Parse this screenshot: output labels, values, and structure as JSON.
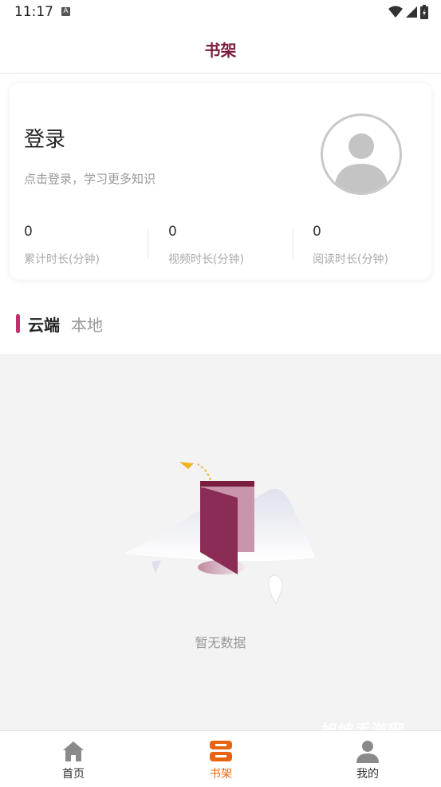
{
  "status_bar": {
    "time": "11:17",
    "notification_icon": "A"
  },
  "header": {
    "title": "书架"
  },
  "profile_card": {
    "title": "登录",
    "subtitle": "点击登录，学习更多知识",
    "stats": [
      {
        "value": "0",
        "label": "累计时长(分钟)"
      },
      {
        "value": "0",
        "label": "视频时长(分钟)"
      },
      {
        "value": "0",
        "label": "阅读时长(分钟)"
      }
    ]
  },
  "tabs": {
    "cloud": "云端",
    "local": "本地"
  },
  "empty_state": {
    "text": "暂无数据"
  },
  "bottom_nav": {
    "items": [
      {
        "label": "首页",
        "icon": "home-icon",
        "color": "#333333"
      },
      {
        "label": "书架",
        "icon": "bookshelf-icon",
        "color": "#e8650f"
      },
      {
        "label": "我的",
        "icon": "user-icon",
        "color": "#333333"
      }
    ]
  },
  "colors": {
    "accent": "#7a1d3e",
    "tab_indicator": "#c0306d",
    "active_nav": "#e8650f"
  },
  "watermark": "旭坤手游网"
}
